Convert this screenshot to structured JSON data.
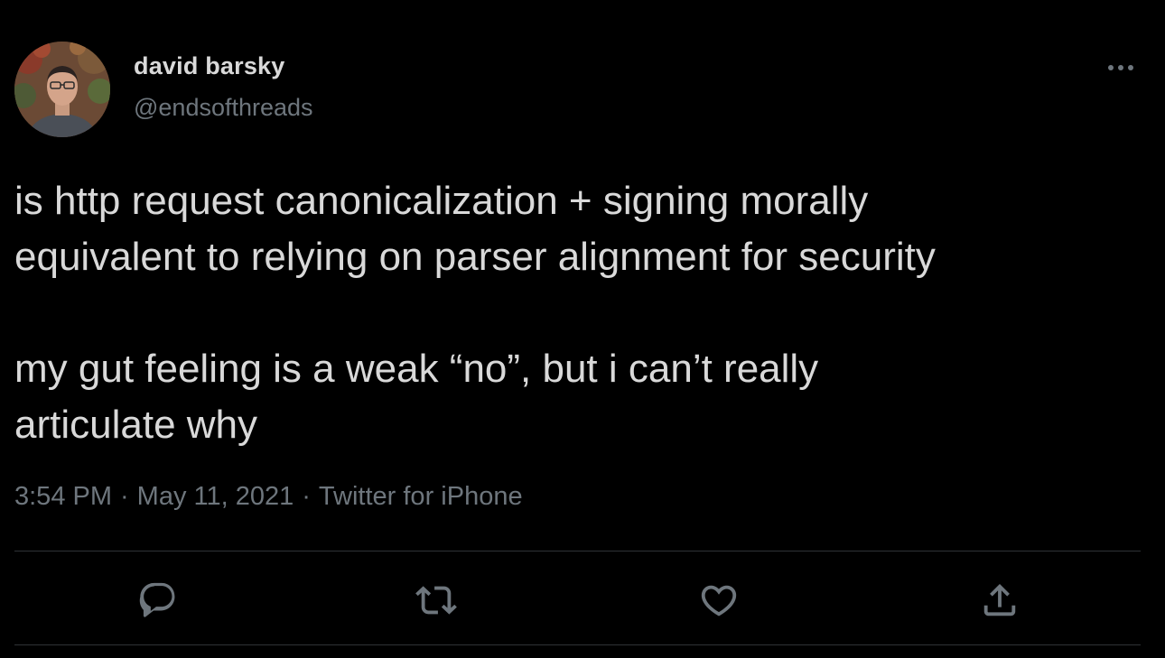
{
  "author": {
    "name": "david barsky",
    "handle": "@endsofthreads"
  },
  "tweet": {
    "paragraph1": [
      "is http request canonicalization + signing morally",
      "equivalent to relying on parser alignment for security"
    ],
    "paragraph2": [
      "my gut feeling is a weak “no”, but i can’t really",
      "articulate why"
    ]
  },
  "meta": {
    "time": "3:54 PM",
    "separator": "·",
    "date": "May 11, 2021",
    "source": "Twitter for iPhone"
  },
  "icons": {
    "more": "more-horizontal-icon",
    "reply": "reply-icon",
    "retweet": "retweet-icon",
    "like": "heart-icon",
    "share": "share-icon"
  },
  "colors": {
    "background": "#000000",
    "text": "#d9d9d9",
    "secondary": "#6e767d",
    "divider": "#2f3336"
  }
}
